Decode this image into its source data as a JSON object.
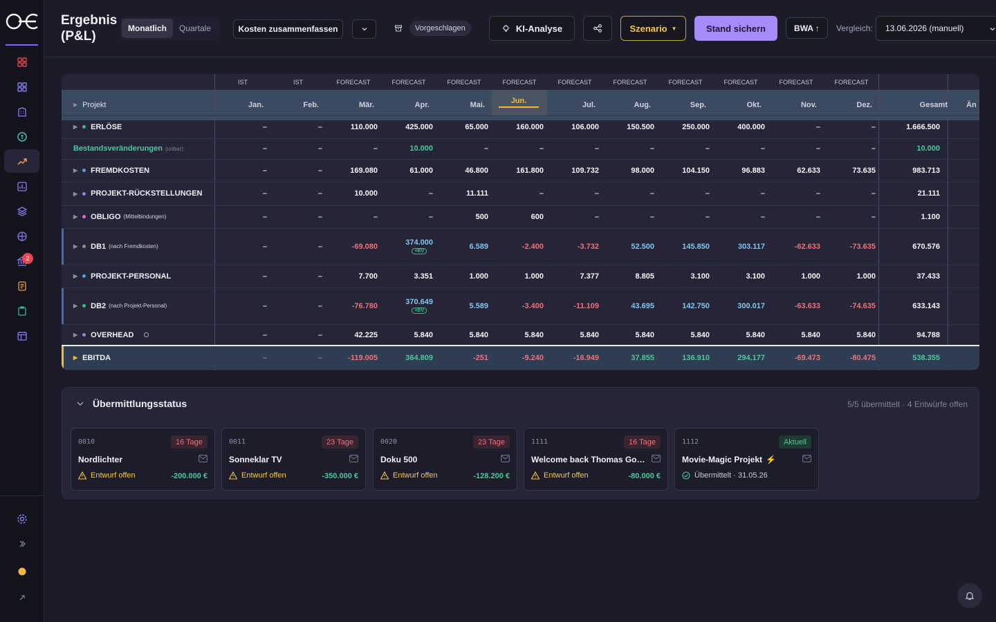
{
  "brand": {
    "logo_text": "oe"
  },
  "sidebar": {
    "items": [
      {
        "icon": "grid-icon"
      },
      {
        "icon": "dashboard-icon"
      },
      {
        "icon": "building-icon"
      },
      {
        "icon": "coin-icon"
      },
      {
        "icon": "trending-up-icon"
      },
      {
        "icon": "bar-chart-icon"
      },
      {
        "icon": "layers-icon"
      },
      {
        "icon": "globe-icon"
      },
      {
        "icon": "bank-icon"
      },
      {
        "icon": "document-icon"
      },
      {
        "icon": "clipboard-icon"
      },
      {
        "icon": "calendar-icon"
      }
    ],
    "badge_count": "2",
    "bottom": [
      {
        "icon": "settings-icon"
      },
      {
        "icon": "expand-icon"
      },
      {
        "icon": "sun-icon"
      },
      {
        "icon": "external-link-icon"
      }
    ]
  },
  "header": {
    "title": "Ergebnis (P&L)",
    "view_toggle": [
      "Monatlich",
      "Quartale"
    ],
    "summary_button": "Kosten zusammenfassen",
    "suggested_chip": "Vorgeschlagen",
    "ai_button": "KI-Analyse",
    "scenario_button": "Szenario",
    "save_button": "Stand sichern",
    "bwa_button": "BWA ↑",
    "compare_label": "Vergleich:",
    "compare_value": "13.06.2026 (manuell)"
  },
  "table": {
    "group_row": [
      "IST",
      "IST",
      "FORECAST",
      "FORECAST",
      "FORECAST",
      "FORECAST",
      "FORECAST",
      "FORECAST",
      "FORECAST",
      "FORECAST",
      "FORECAST",
      "FORECAST"
    ],
    "first_col_header": "Projekt",
    "months": [
      "Jan.",
      "Feb.",
      "Mär.",
      "Apr.",
      "Mai.",
      "Jun.",
      "Jul.",
      "Aug.",
      "Sep.",
      "Okt.",
      "Nov.",
      "Dez."
    ],
    "total_header": "Gesamt",
    "change_header": "Än",
    "rows": [
      {
        "label": "ERLÖSE",
        "sub": "",
        "dot": "#3fb889",
        "values": [
          "–",
          "–",
          "110.000",
          "425.000",
          "65.000",
          "160.000",
          "106.000",
          "150.500",
          "250.000",
          "400.000",
          "–",
          "–"
        ],
        "total": "1.666.500"
      },
      {
        "label": "Bestandsveränderungen",
        "sub": "(unbar)",
        "dot": "",
        "values": [
          "–",
          "–",
          "–",
          "10.000",
          "–",
          "–",
          "–",
          "–",
          "–",
          "–",
          "–",
          "–"
        ],
        "total": "10.000"
      },
      {
        "label": "FREMDKOSTEN",
        "sub": "",
        "dot": "#48a6e8",
        "values": [
          "–",
          "–",
          "169.080",
          "61.000",
          "46.800",
          "161.800",
          "109.732",
          "98.000",
          "104.150",
          "96.883",
          "62.633",
          "73.635"
        ],
        "total": "983.713"
      },
      {
        "label": "PROJEKT-RÜCKSTELLUNGEN",
        "sub": "",
        "dot": "#9b7cf0",
        "values": [
          "–",
          "–",
          "10.000",
          "–",
          "11.111",
          "–",
          "–",
          "–",
          "–",
          "–",
          "–",
          "–"
        ],
        "total": "21.111"
      },
      {
        "label": "OBLIGO",
        "sub": "(Mittelbindungen)",
        "dot": "#d86cd6",
        "values": [
          "–",
          "–",
          "–",
          "–",
          "500",
          "600",
          "–",
          "–",
          "–",
          "–",
          "–",
          "–"
        ],
        "total": "1.100"
      },
      {
        "label": "DB1",
        "sub": "(nach Fremdkosten)",
        "dot": "#8b8ea0",
        "values": [
          "–",
          "–",
          "-69.080",
          "374.000",
          "6.589",
          "-2.400",
          "-3.732",
          "52.500",
          "145.850",
          "303.117",
          "-62.633",
          "-73.635"
        ],
        "total": "670.576",
        "bv_badge": "+BV"
      },
      {
        "label": "PROJEKT-PERSONAL",
        "sub": "",
        "dot": "#48a6e8",
        "values": [
          "–",
          "–",
          "7.700",
          "3.351",
          "1.000",
          "1.000",
          "7.377",
          "8.805",
          "3.100",
          "3.100",
          "1.000",
          "1.000"
        ],
        "total": "37.433"
      },
      {
        "label": "DB2",
        "sub": "(nach Projekt-Personal)",
        "dot": "#3fb889",
        "values": [
          "–",
          "–",
          "-76.780",
          "370.649",
          "5.589",
          "-3.400",
          "-11.109",
          "43.695",
          "142.750",
          "300.017",
          "-63.633",
          "-74.635"
        ],
        "total": "633.143",
        "bv_badge": "+BV"
      },
      {
        "label": "OVERHEAD",
        "sub": "",
        "dot": "#9b7cf0",
        "values": [
          "–",
          "–",
          "42.225",
          "5.840",
          "5.840",
          "5.840",
          "5.840",
          "5.840",
          "5.840",
          "5.840",
          "5.840",
          "5.840"
        ],
        "total": "94.788"
      },
      {
        "label": "EBITDA",
        "sub": "",
        "dot": "",
        "values": [
          "–",
          "–",
          "-119.005",
          "364.809",
          "-251",
          "-9.240",
          "-16.949",
          "37.855",
          "136.910",
          "294.177",
          "-69.473",
          "-80.475"
        ],
        "total": "538.355"
      }
    ]
  },
  "status": {
    "title": "Übermittlungsstatus",
    "summary": "5/5 übermittelt · 4 Entwürfe offen",
    "cards": [
      {
        "id": "0010",
        "badge": "16 Tage",
        "name": "Nordlichter",
        "state": "Entwurf offen",
        "amount": "-200.000 €"
      },
      {
        "id": "0011",
        "badge": "23 Tage",
        "name": "Sonneklar TV",
        "state": "Entwurf offen",
        "amount": "-350.000 €"
      },
      {
        "id": "0020",
        "badge": "23 Tage",
        "name": "Doku 500",
        "state": "Entwurf offen",
        "amount": "-128.200 €"
      },
      {
        "id": "1111",
        "badge": "16 Tage",
        "name": "Welcome back Thomas Gotts...",
        "state": "Entwurf offen",
        "amount": "-80.000 €"
      },
      {
        "id": "1112",
        "badge": "Aktuell",
        "name": "Movie-Magic Projekt",
        "state": "Übermittelt · 31.05.26",
        "amount": ""
      }
    ]
  },
  "colors": {
    "accent": "#a78bfa",
    "positive": "#4ec79a",
    "negative": "#f1707a",
    "highlight_month": "#f5b83d"
  }
}
